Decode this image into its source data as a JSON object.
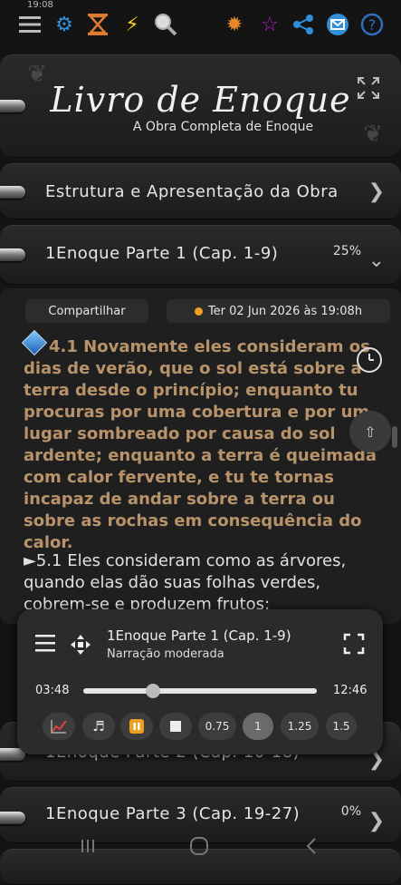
{
  "status": {
    "time": "19:08"
  },
  "toolbar": {
    "left_icons": [
      "menu-icon",
      "gear-icon",
      "hourglass-icon",
      "lightning-icon",
      "search-icon"
    ],
    "right_icons": [
      "sun-icon",
      "star-icon",
      "share-icon",
      "mail-icon",
      "help-icon"
    ]
  },
  "header": {
    "title": "Livro de Enoque",
    "subtitle": "A Obra Completa de Enoque",
    "expand_icon": "expand-icon"
  },
  "sections": {
    "intro": {
      "label": "Estrutura e Apresentação da Obra"
    },
    "part1": {
      "label": "1Enoque Parte 1 (Cap. 1-9)",
      "progress": "25%"
    },
    "part2": {
      "label": "1Enoque Parte 2 (Cap. 10-18)"
    },
    "part3": {
      "label": "1Enoque Parte 3 (Cap. 19-27)",
      "progress": "0%"
    }
  },
  "content": {
    "share_label": "Compartilhar",
    "date_label": "Ter 02 Jun 2026 às 19:08h",
    "verse_highlight": "4.1 Novamente eles consideram os dias de verão, que o sol está sobre a terra desde o princípio; enquanto tu procuras por uma cobertura e por um lugar sombreado por causa do sol ardente; enquanto a terra é queimada com calor fervente, e tu te tornas incapaz de andar sobre a terra ou sobre as rochas em consequência do calor.",
    "verse_next": "►5.1 Eles consideram como as árvores, quando elas dão suas folhas verdes, cobrem-se e produzem frutos;"
  },
  "player": {
    "title": "1Enoque Parte 1 (Cap. 1-9)",
    "subtitle": "Narração moderada",
    "current_time": "03:48",
    "total_time": "12:46",
    "progress": 0.3,
    "speeds": [
      "0.75",
      "1",
      "1.25",
      "1.5"
    ],
    "active_speed": "1"
  },
  "colors": {
    "accent_orange": "#f0a020",
    "verse_color": "#b8936a",
    "gear_blue": "#2f8fd8"
  }
}
